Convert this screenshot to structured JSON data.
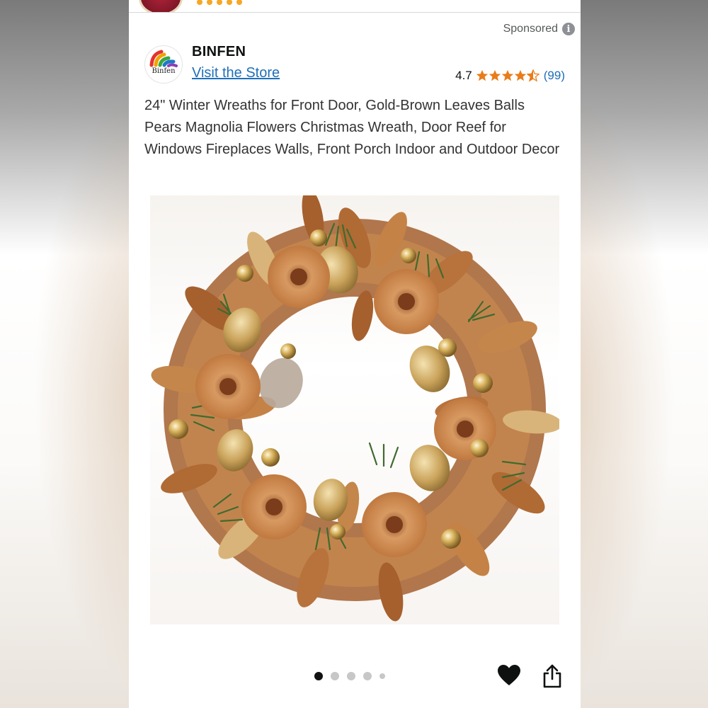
{
  "ad": {
    "sponsored_label": "Sponsored",
    "info_icon": "info-icon"
  },
  "brand": {
    "name": "BINFEN",
    "logo_text": "Binfen",
    "store_link": "Visit the Store"
  },
  "rating": {
    "value": "4.7",
    "stars": 4.5,
    "count": "(99)",
    "star_color": "#e97c1a"
  },
  "product": {
    "title": "24\" Winter Wreaths for Front Door, Gold-Brown Leaves Balls Pears Magnolia Flowers Christmas Wreath, Door Reef for Windows Fireplaces Walls, Front Porch Indoor and Outdoor Decor",
    "image_dots": 5,
    "active_dot": 1
  },
  "actions": {
    "favorite_icon": "heart-icon",
    "share_icon": "share-icon"
  },
  "colors": {
    "link": "#1f6fb8",
    "text": "#333333",
    "leaf_brown": "#b8723c",
    "leaf_gold": "#d9b47a",
    "pine_green": "#3f6b2e"
  }
}
